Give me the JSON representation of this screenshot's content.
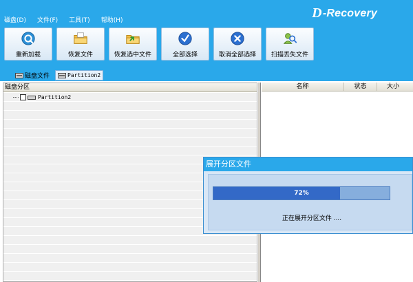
{
  "menu": [
    "磁盘(D)",
    "文件(F)",
    "工具(T)",
    "帮助(H)"
  ],
  "logo": {
    "mark": "D",
    "text": "-Recovery"
  },
  "toolbar": [
    {
      "name": "reload-button",
      "icon": "refresh-icon",
      "label": "重新加载"
    },
    {
      "name": "recover-files-button",
      "icon": "folder-icon",
      "label": "恢复文件"
    },
    {
      "name": "recover-selected-button",
      "icon": "folder-arrow-icon",
      "label": "恢复选中文件"
    },
    {
      "name": "select-all-button",
      "icon": "check-circle-icon",
      "label": "全部选择"
    },
    {
      "name": "deselect-all-button",
      "icon": "x-circle-icon",
      "label": "取消全部选择"
    },
    {
      "name": "scan-lost-files-button",
      "icon": "search-person-icon",
      "label": "扫描丢失文件"
    }
  ],
  "tabs": [
    {
      "label": "磁盘文件",
      "active": false
    },
    {
      "label": "Partition2",
      "active": true
    }
  ],
  "left_pane": {
    "header": "磁盘分区",
    "tree": [
      {
        "label": "Partition2",
        "checked": false
      }
    ]
  },
  "right_pane": {
    "columns": [
      "名称",
      "状态",
      "大小"
    ]
  },
  "dialog": {
    "title": "展开分区文件",
    "progress_percent": 72,
    "progress_text": "72%",
    "status": "正在展开分区文件 ...."
  },
  "colors": {
    "header_bg": "#2aa8ea",
    "progress_fill": "#3369c7",
    "progress_bg": "#86aedd",
    "dialog_bg": "#d9e7f6"
  }
}
